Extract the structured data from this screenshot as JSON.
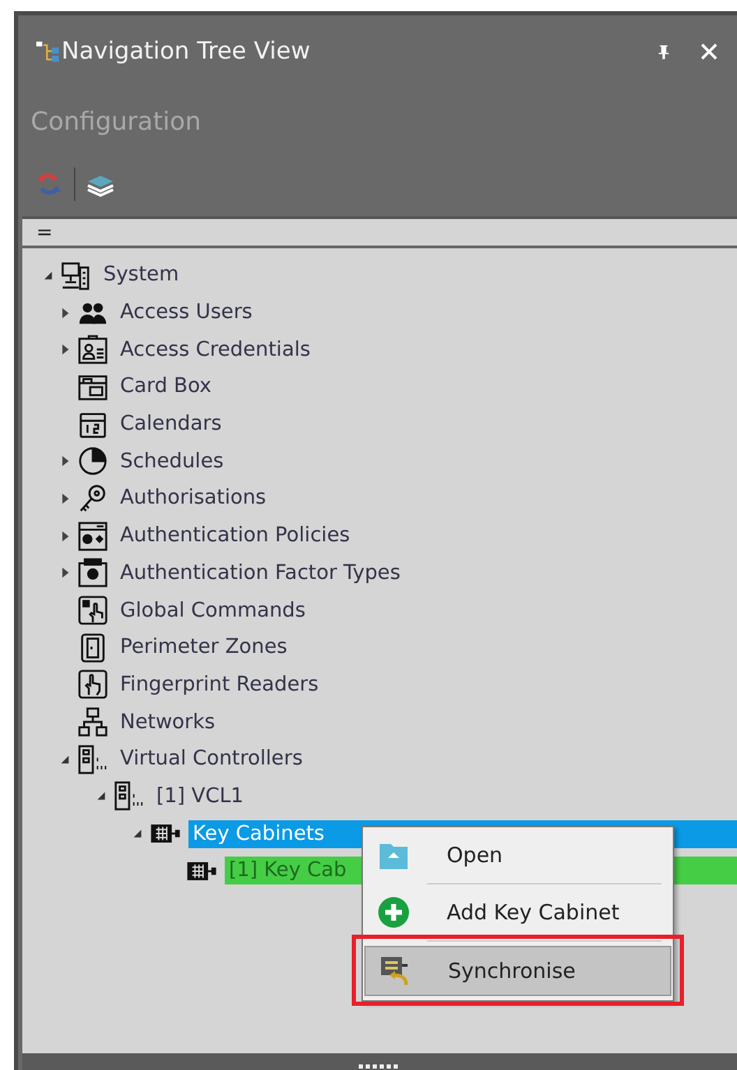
{
  "window": {
    "title": "Navigation Tree View"
  },
  "section": {
    "title": "Configuration"
  },
  "header": {
    "label": "="
  },
  "tree": [
    {
      "label": "System",
      "kind": "system",
      "expanded": true,
      "selected": false,
      "children": [
        {
          "label": "Access Users",
          "kind": "users",
          "expanded": false,
          "selected": false
        },
        {
          "label": "Access Credentials",
          "kind": "credential",
          "expanded": false,
          "selected": false
        },
        {
          "label": "Card Box",
          "kind": "cardbox",
          "selected": false
        },
        {
          "label": "Calendars",
          "kind": "calendar",
          "selected": false
        },
        {
          "label": "Schedules",
          "kind": "clock",
          "expanded": false,
          "selected": false
        },
        {
          "label": "Authorisations",
          "kind": "key",
          "expanded": false,
          "selected": false
        },
        {
          "label": "Authentication Policies",
          "kind": "policy",
          "expanded": false,
          "selected": false
        },
        {
          "label": "Authentication Factor Types",
          "kind": "factor",
          "expanded": false,
          "selected": false
        },
        {
          "label": "Global Commands",
          "kind": "command",
          "selected": false
        },
        {
          "label": "Perimeter Zones",
          "kind": "door",
          "selected": false
        },
        {
          "label": "Fingerprint Readers",
          "kind": "finger",
          "selected": false
        },
        {
          "label": "Networks",
          "kind": "network",
          "selected": false
        },
        {
          "label": "Virtual Controllers",
          "kind": "controller",
          "expanded": true,
          "selected": false,
          "children": [
            {
              "label": "[1] VCL1",
              "kind": "controller",
              "expanded": true,
              "selected": false,
              "children": [
                {
                  "label": "Key Cabinets",
                  "kind": "cabinet",
                  "expanded": true,
                  "selected": true,
                  "children": [
                    {
                      "label": "[1] Key Cab",
                      "kind": "cabinet",
                      "selected": false,
                      "color": "#46cd46"
                    }
                  ]
                }
              ]
            }
          ]
        }
      ]
    }
  ],
  "context_menu": [
    {
      "label": "Open",
      "kind": "open",
      "selected": false,
      "marked": false
    },
    {
      "label": "Add Key Cabinet",
      "kind": "add",
      "selected": false,
      "marked": false
    },
    {
      "label": "Synchronise",
      "kind": "sync",
      "selected": true,
      "marked": true
    }
  ]
}
